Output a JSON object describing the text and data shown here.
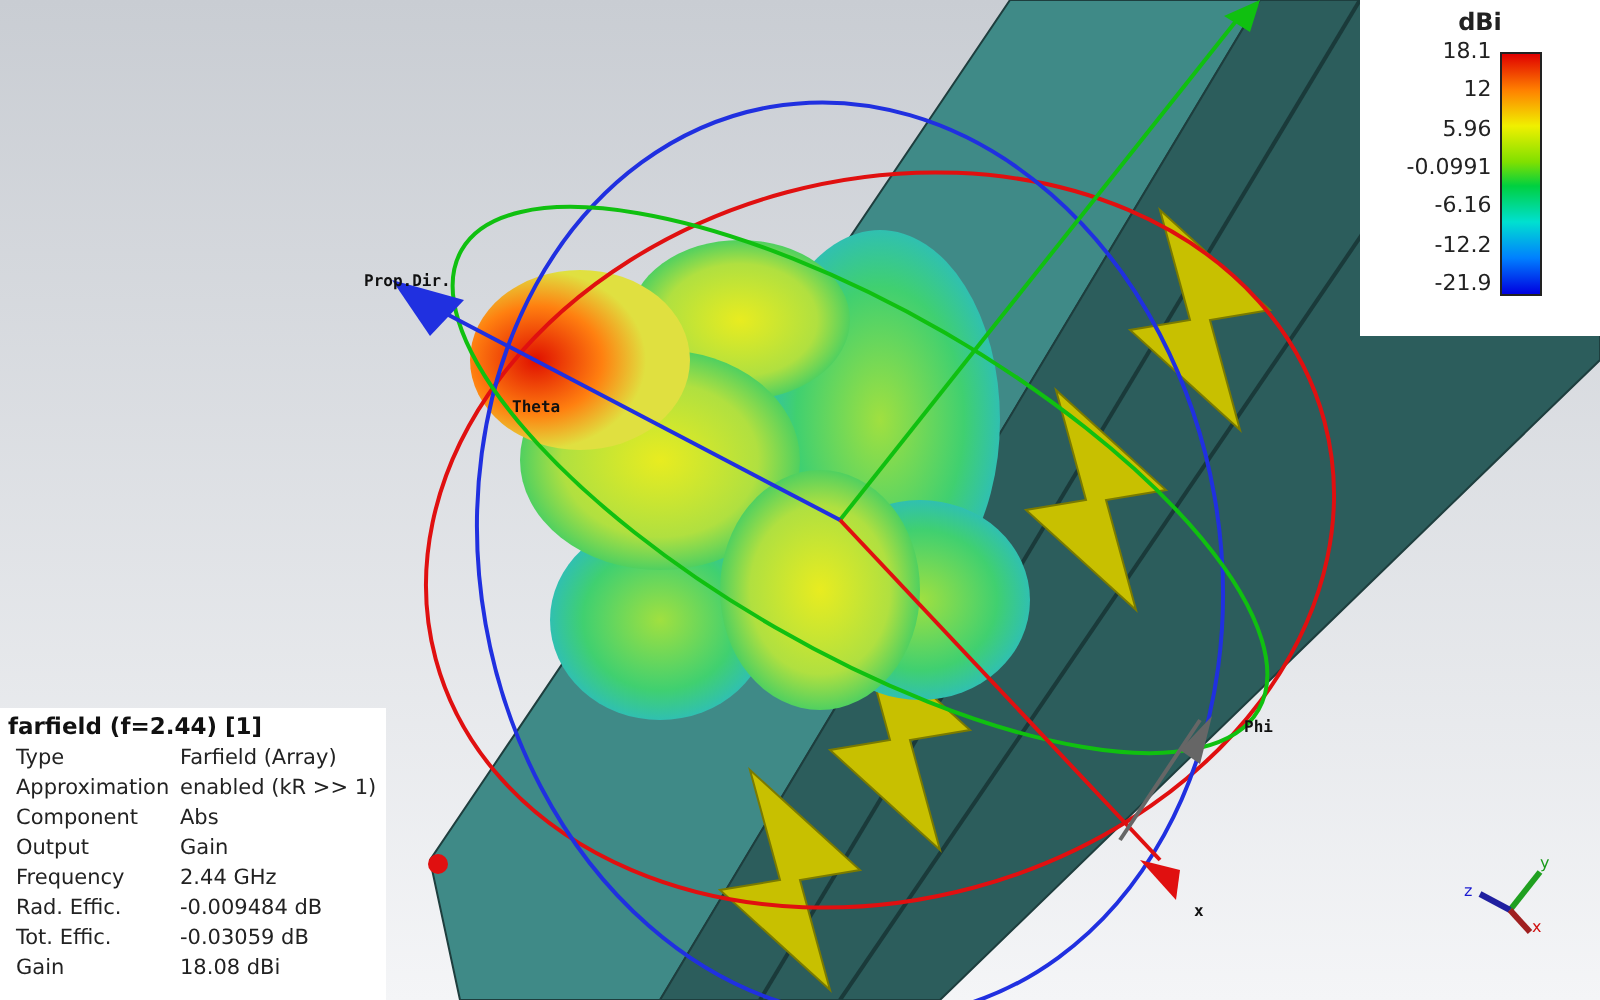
{
  "legend": {
    "unit": "dBi",
    "ticks": [
      "18.1",
      "12",
      "5.96",
      "-0.0991",
      "-6.16",
      "-12.2",
      "-21.9"
    ]
  },
  "info": {
    "title": "farfield (f=2.44) [1]",
    "rows": [
      {
        "label": "Type",
        "value": "Farfield (Array)"
      },
      {
        "label": "Approximation",
        "value": "enabled (kR >> 1)"
      },
      {
        "label": "Component",
        "value": "Abs"
      },
      {
        "label": "Output",
        "value": "Gain"
      },
      {
        "label": "Frequency",
        "value": "2.44 GHz"
      },
      {
        "label": "Rad. Effic.",
        "value": "-0.009484 dB"
      },
      {
        "label": "Tot. Effic.",
        "value": "-0.03059 dB"
      },
      {
        "label": "Gain",
        "value": "18.08 dBi"
      }
    ]
  },
  "scene": {
    "labels": [
      {
        "kind": "prop",
        "text": "Prop.Dir."
      },
      {
        "kind": "theta",
        "text": "Theta"
      },
      {
        "kind": "phi",
        "text": "Phi"
      },
      {
        "kind": "x",
        "text": "x"
      }
    ]
  },
  "triad": {
    "labels": [
      {
        "kind": "y",
        "text": "y"
      },
      {
        "kind": "z",
        "text": "z"
      },
      {
        "kind": "x",
        "text": "x"
      }
    ]
  }
}
